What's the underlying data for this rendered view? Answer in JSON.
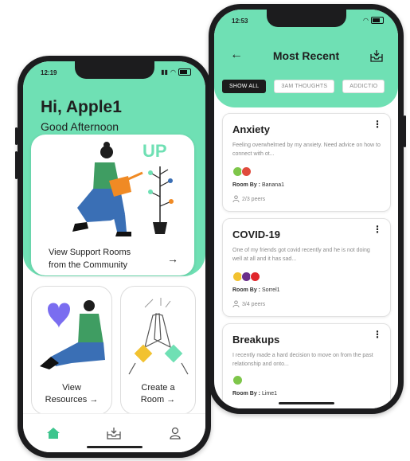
{
  "left_phone": {
    "status_time": "12:19",
    "greeting": "Hi, Apple1",
    "greeting_sub": "Good Afternoon",
    "main_card": {
      "illustration_text": "UP",
      "label_line1": "View Support Rooms",
      "label_line2": "from the Community",
      "arrow": "→"
    },
    "resources_card": {
      "label_line1": "View",
      "label_line2": "Resources",
      "arrow": "→"
    },
    "room_card": {
      "label_line1": "Create a",
      "label_line2": "Room",
      "arrow": "→"
    },
    "nav": [
      "home-icon",
      "inbox-icon",
      "profile-icon"
    ],
    "colors": {
      "accent": "#6fe0b4",
      "active_nav": "#3ec58e"
    }
  },
  "right_phone": {
    "status_time": "12:53",
    "title": "Most Recent",
    "back_arrow": "←",
    "chips": [
      "SHOW ALL",
      "3AM THOUGHTS",
      "ADDICTIO"
    ],
    "rooms": [
      {
        "title": "Anxiety",
        "description": "Feeling overwhelmed by my anxiety. Need advice on how to connect with ot...",
        "dot_colors": [
          "#7ec64a",
          "#e04a3c"
        ],
        "room_by_label": "Room By :",
        "room_by": "Banana1",
        "peers": "2/3 peers"
      },
      {
        "title": "COVID-19",
        "description": "One of my friends got covid recently and he is not doing well at all and it has sad...",
        "dot_colors": [
          "#f2c230",
          "#6a2f8a",
          "#e0262b"
        ],
        "room_by_label": "Room By :",
        "room_by": "Sorrel1",
        "peers": "3/4 peers"
      },
      {
        "title": "Breakups",
        "description": "I recently made a hard decision to move on from the past relationship and onto...",
        "dot_colors": [
          "#7ec64a"
        ],
        "room_by_label": "Room By :",
        "room_by": "Lime1",
        "peers": ""
      }
    ],
    "menu_glyph": "⋮"
  }
}
